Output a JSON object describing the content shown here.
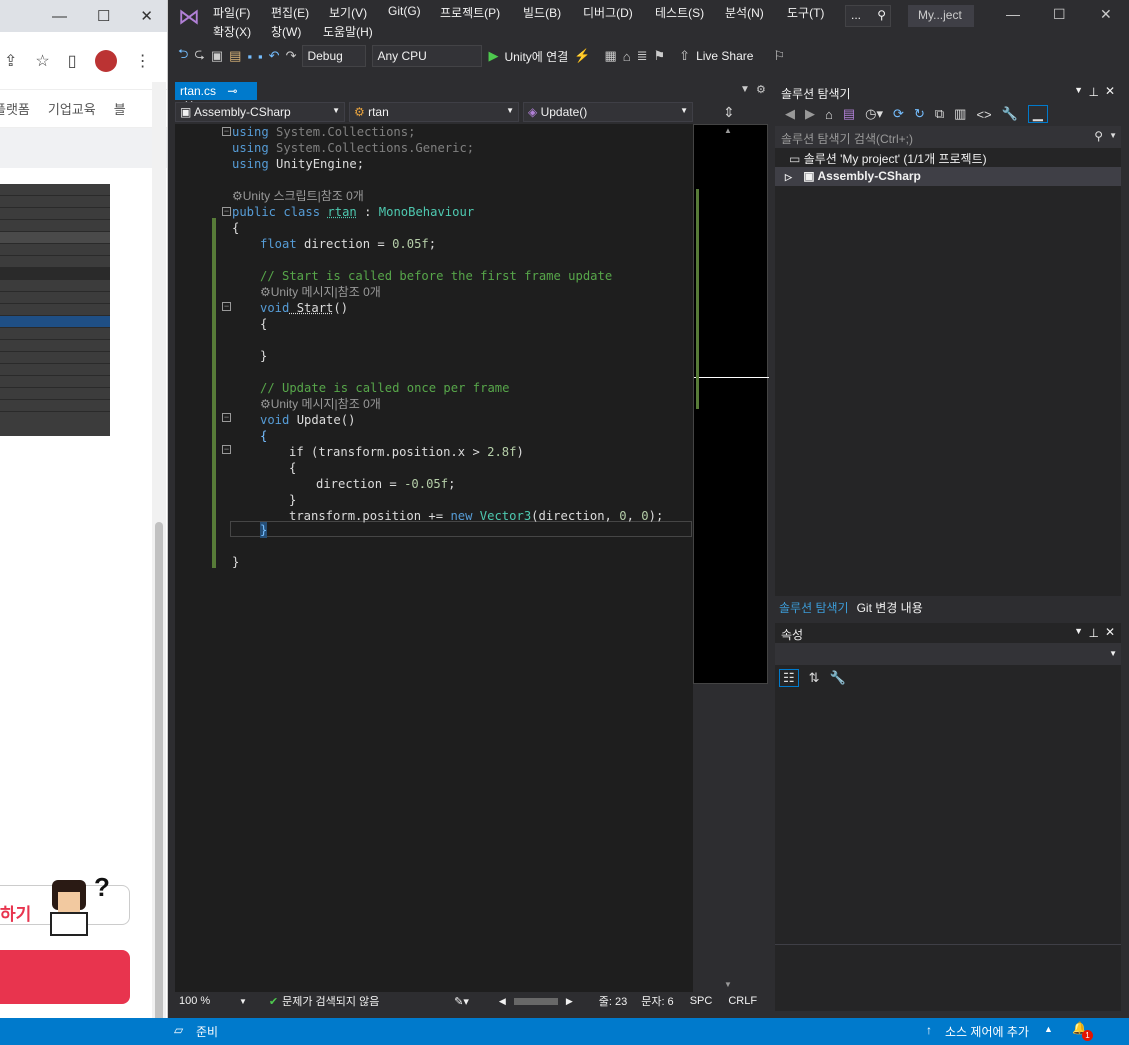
{
  "browser": {
    "nav_items": [
      "플랫폼",
      "기업교육",
      "블"
    ],
    "cta_text": "하기"
  },
  "vs": {
    "menu": [
      "파일(F)",
      "편집(E)",
      "보기(V)",
      "Git(G)",
      "프로젝트(P)",
      "빌드(B)",
      "디버그(D)",
      "테스트(S)",
      "분석(N)",
      "도구(T)",
      "확장(X)",
      "창(W)",
      "도움말(H)"
    ],
    "search_text": "...",
    "window_title": "My...ject",
    "toolbar": {
      "config": "Debug",
      "platform": "Any CPU",
      "run_label": "Unity에 연결",
      "live_share": "Live Share"
    },
    "doc_tab": "rtan.cs",
    "nav": {
      "project": "Assembly-CSharp",
      "class": "rtan",
      "member": "Update()"
    },
    "code": {
      "l1_kw": "using",
      "l1_rest": " System.Collections;",
      "l2_kw": "using",
      "l2_rest": " System.Collections.Generic;",
      "l3_kw": "using",
      "l3_rest": " UnityEngine;",
      "ref_class": "Unity 스크립트|참조 0개",
      "l5_a": "public class ",
      "l5_b": "rtan",
      "l5_c": " : ",
      "l5_d": "MonoBehaviour",
      "brace_open": "{",
      "l7_a": "float",
      "l7_b": " direction = ",
      "l7_c": "0.05f",
      "l7_d": ";",
      "c1": "// Start is called before the first frame update",
      "ref_start": "Unity 메시지|참조 0개",
      "l10_a": "void",
      "l10_b": " Start",
      "l10_c": "()",
      "l11": "{",
      "l13": "}",
      "c2": "// Update is called once per frame",
      "ref_update": "Unity 메시지|참조 0개",
      "l17_a": "void",
      "l17_b": " Update",
      "l17_c": "()",
      "l18": "{",
      "l19_a": "if",
      "l19_b": " (transform.position.x > ",
      "l19_c": "2.8f",
      "l19_d": ")",
      "l20": "{",
      "l21_a": "direction = ",
      "l21_b": "-0.05f",
      "l21_c": ";",
      "l22": "}",
      "l23_a": "transform.position += ",
      "l23_b": "new",
      "l23_c": " ",
      "l23_d": "Vector3",
      "l23_e": "(direction, ",
      "l23_f": "0",
      "l23_g": ", ",
      "l23_h": "0",
      "l23_i": ");",
      "l24": "}",
      "l26": "}"
    },
    "editor_status": {
      "zoom": "100 %",
      "issues": "문제가 검색되지 않음",
      "line": "줄: 23",
      "col": "문자: 6",
      "spc": "SPC",
      "eol": "CRLF"
    },
    "solution_explorer": {
      "title": "솔루션 탐색기",
      "search_placeholder": "솔루션 탐색기 검색(Ctrl+;)",
      "solution": "솔루션 'My project' (1/1개 프로젝트)",
      "project": "Assembly-CSharp",
      "tab1": "솔루션 탐색기",
      "tab2": "Git 변경 내용"
    },
    "properties": {
      "title": "속성"
    },
    "status": {
      "ready": "준비",
      "source_control": "소스 제어에 추가",
      "notif_count": "1"
    }
  }
}
